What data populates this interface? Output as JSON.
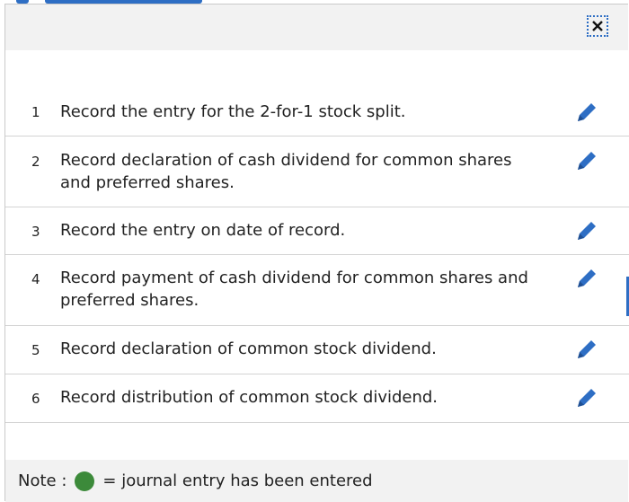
{
  "colors": {
    "accent": "#2e6ec4",
    "entered_dot": "#3c8a3a",
    "header_bg": "#f2f2f2"
  },
  "dialog": {
    "close_icon": "close-icon"
  },
  "tasks": [
    {
      "number": "1",
      "text": "Record the entry for the 2-for-1 stock split.",
      "icon": "pencil-icon"
    },
    {
      "number": "2",
      "text": "Record declaration of cash dividend for common shares and preferred shares.",
      "icon": "pencil-icon"
    },
    {
      "number": "3",
      "text": "Record the entry on date of record.",
      "icon": "pencil-icon"
    },
    {
      "number": "4",
      "text": "Record payment of cash dividend for common shares and preferred shares.",
      "icon": "pencil-icon"
    },
    {
      "number": "5",
      "text": "Record declaration of common stock dividend.",
      "icon": "pencil-icon"
    },
    {
      "number": "6",
      "text": "Record distribution of common stock dividend.",
      "icon": "pencil-icon"
    }
  ],
  "footer": {
    "note_label": "Note :",
    "legend_text": "= journal entry has been entered"
  }
}
